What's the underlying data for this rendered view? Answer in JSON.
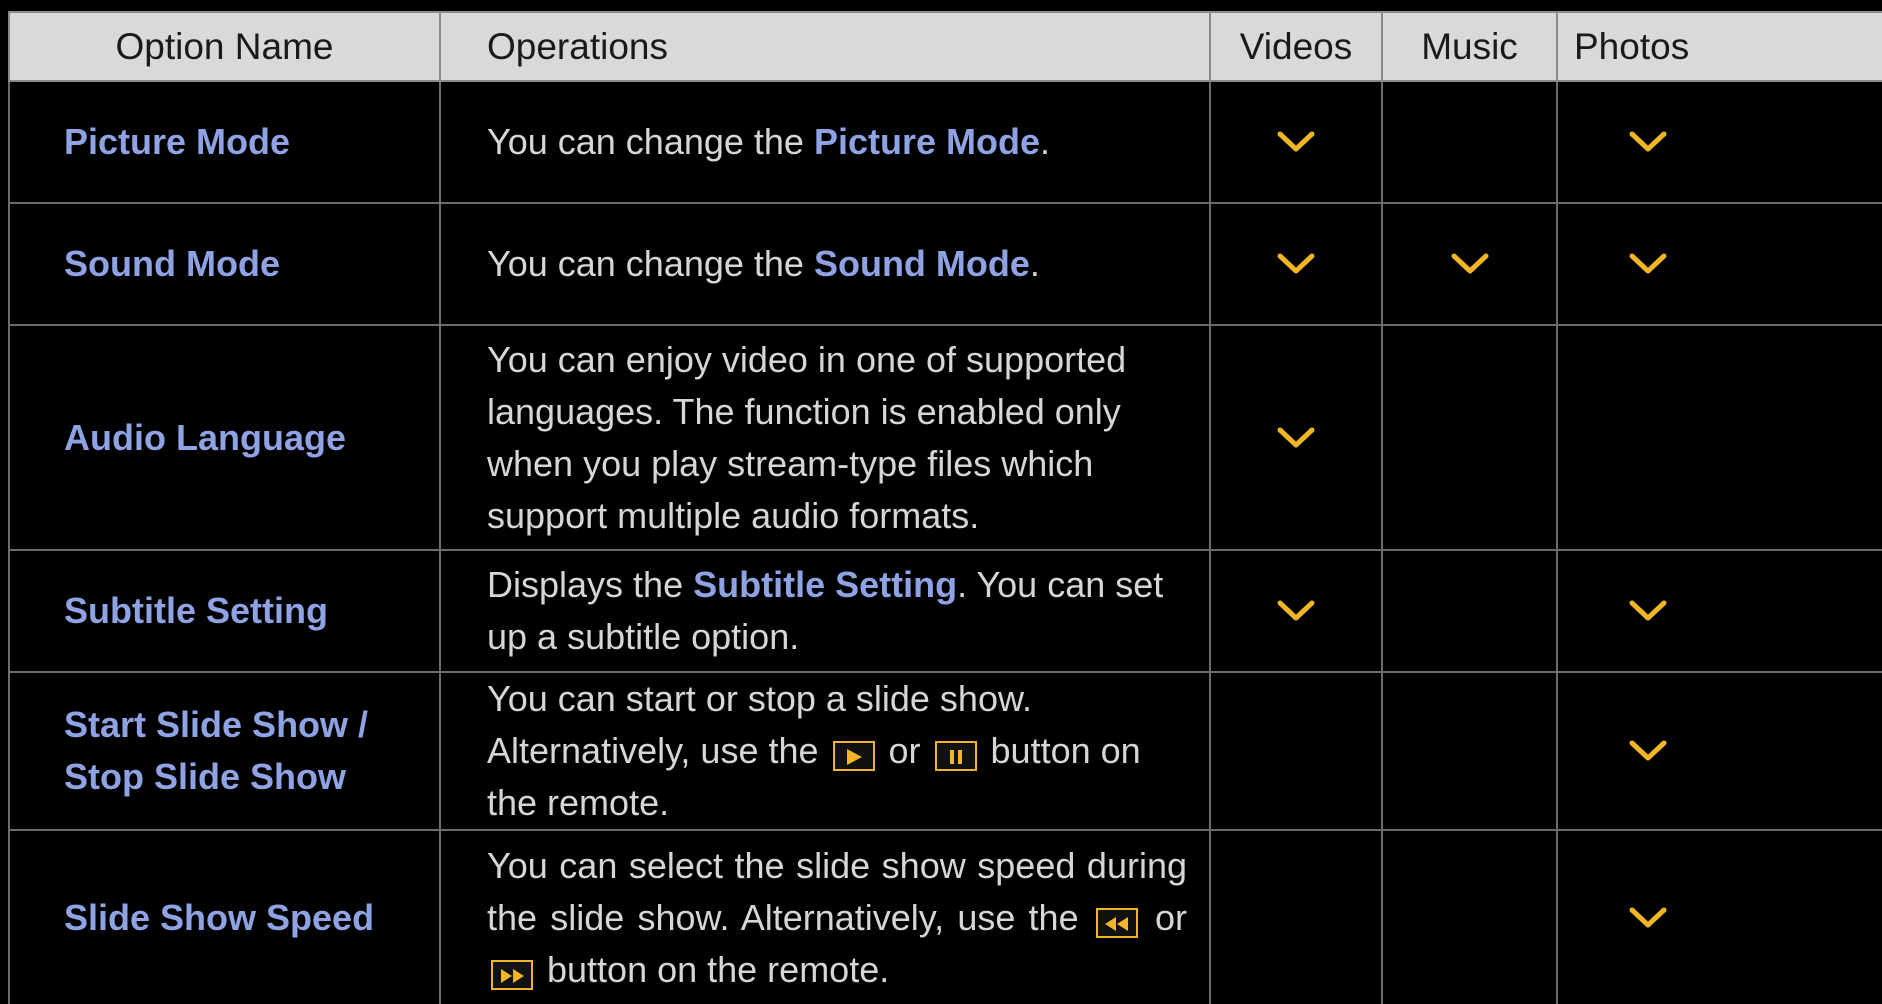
{
  "header": {
    "option_name": "Option Name",
    "operations": "Operations",
    "videos": "Videos",
    "music": "Music",
    "photos": "Photos"
  },
  "colors": {
    "option_blue": "#8fa3e4",
    "check_gold": "#f2b526",
    "header_bg": "#d9d9d9"
  },
  "rows": [
    {
      "name": "Picture Mode",
      "ops_pre": "You can change the ",
      "ops_hl": "Picture Mode",
      "ops_post": ".",
      "videos": true,
      "music": false,
      "photos": true
    },
    {
      "name": "Sound Mode",
      "ops_pre": "You can change the ",
      "ops_hl": "Sound Mode",
      "ops_post": ".",
      "videos": true,
      "music": true,
      "photos": true
    },
    {
      "name": "Audio Language",
      "ops": "You can enjoy video in one of supported languages. The function is enabled only when you play stream-type files which support multiple audio formats.",
      "videos": true,
      "music": false,
      "photos": false
    },
    {
      "name": "Subtitle Setting",
      "ops_pre": "Displays the ",
      "ops_hl": "Subtitle Setting",
      "ops_post": ". You can set up a subtitle option.",
      "videos": true,
      "music": false,
      "photos": true
    },
    {
      "name": "Start Slide Show / Stop Slide Show",
      "ops_pre": "You can start or stop a slide show. Alternatively, use the ",
      "ops_mid": " or ",
      "ops_post": " button on the remote.",
      "btn1_icon": "play-icon",
      "btn2_icon": "pause-icon",
      "videos": false,
      "music": false,
      "photos": true
    },
    {
      "name": "Slide Show Speed",
      "ops_pre": "You can select the slide show speed during the slide show. Alternatively, use the ",
      "ops_mid": " or ",
      "ops_post": " button on the remote.",
      "btn1_icon": "rewind-icon",
      "btn2_icon": "fast-forward-icon",
      "videos": false,
      "music": false,
      "photos": true
    }
  ]
}
